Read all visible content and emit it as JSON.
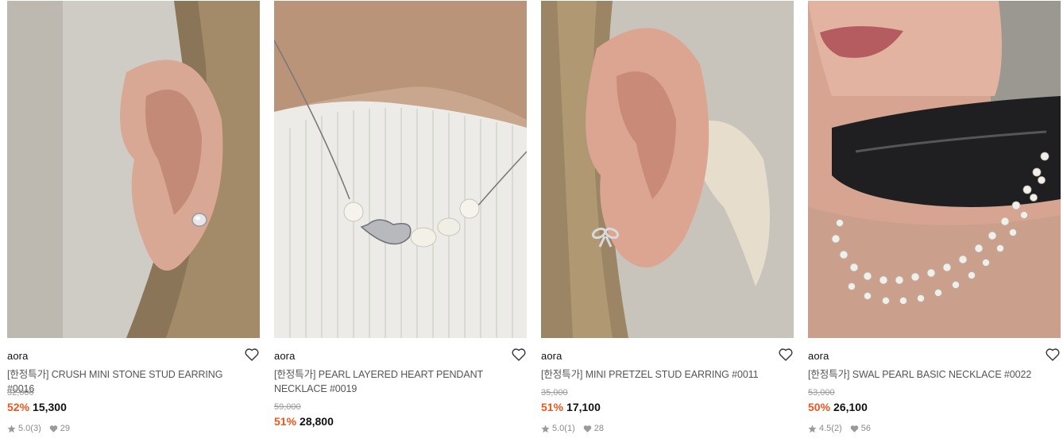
{
  "products": [
    {
      "brand": "aora",
      "title": "[한정특가] CRUSH MINI STONE STUD EARRING #0016",
      "original_price": "32,000",
      "discount": "52%",
      "price": "15,300",
      "rating": "5.0",
      "review_count": "(3)",
      "likes": "29"
    },
    {
      "brand": "aora",
      "title": "[한정특가] PEARL LAYERED HEART PENDANT NECKLACE #0019",
      "original_price": "59,000",
      "discount": "51%",
      "price": "28,800"
    },
    {
      "brand": "aora",
      "title": "[한정특가] MINI PRETZEL STUD EARRING #0011",
      "original_price": "35,000",
      "discount": "51%",
      "price": "17,100",
      "rating": "5.0",
      "review_count": "(1)",
      "likes": "28"
    },
    {
      "brand": "aora",
      "title": "[한정특가] SWAL PEARL BASIC NECKLACE #0022",
      "original_price": "53,000",
      "discount": "50%",
      "price": "26,100",
      "rating": "4.5",
      "review_count": "(2)",
      "likes": "56"
    }
  ],
  "colors": {
    "discount": "#f0561d",
    "original_price": "#9a9a9a",
    "meta": "#8a8a8a"
  },
  "icons": [
    "heart-outline-icon",
    "star-icon",
    "heart-filled-icon"
  ]
}
